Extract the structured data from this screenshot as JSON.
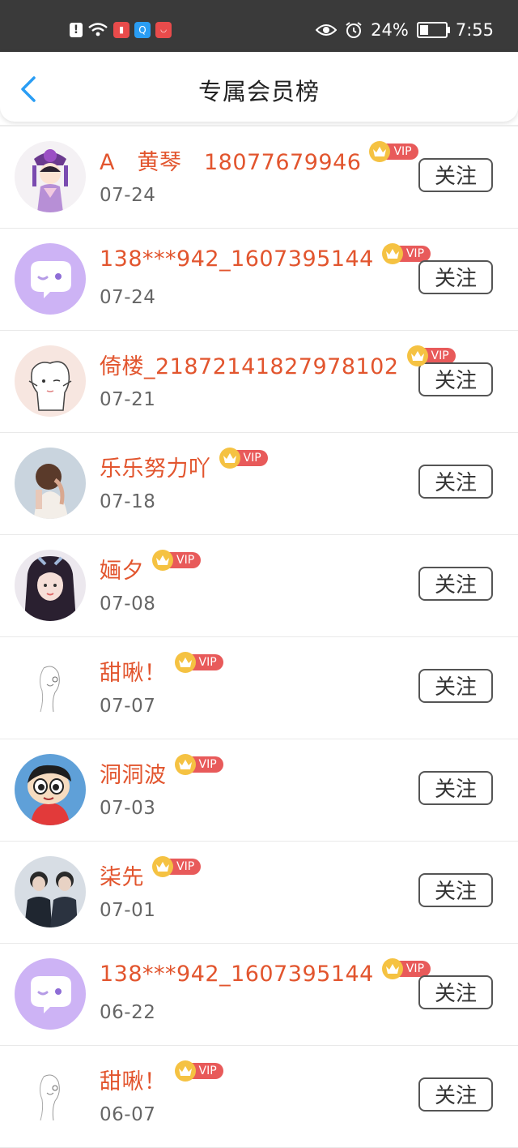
{
  "status_bar": {
    "battery": "24%",
    "time": "7:55",
    "icons": [
      "warning-icon",
      "wifi-icon",
      "app-icon",
      "search-app-icon",
      "huawei-app-icon",
      "eye-icon",
      "alarm-icon",
      "battery-icon"
    ]
  },
  "header": {
    "title": "专属会员榜",
    "back_icon": "chevron-left-icon"
  },
  "colors": {
    "accent_name": "#e2552e",
    "vip_tag": "#e85a5a",
    "crown": "#f5c242",
    "back_arrow": "#2a9df4"
  },
  "follow_label": "关注",
  "vip_label": "VIP",
  "members": [
    {
      "name": "A　黄琴　18077679946",
      "date": "07-24",
      "avatar": "avatar-qing-princess"
    },
    {
      "name": "138***942_1607395144",
      "date": "07-24",
      "avatar": "avatar-default-chat"
    },
    {
      "name": "倚楼_21872141827978102",
      "date": "07-21",
      "avatar": "avatar-alpaca"
    },
    {
      "name": "乐乐努力吖",
      "date": "07-18",
      "avatar": "avatar-girl-back"
    },
    {
      "name": "婳夕",
      "date": "07-08",
      "avatar": "avatar-girl-photo"
    },
    {
      "name": "甜啾！",
      "date": "07-07",
      "avatar": "avatar-sketch-girl"
    },
    {
      "name": "洞洞波",
      "date": "07-03",
      "avatar": "avatar-cartoon-boy"
    },
    {
      "name": "柒先",
      "date": "07-01",
      "avatar": "avatar-two-men"
    },
    {
      "name": "138***942_1607395144",
      "date": "06-22",
      "avatar": "avatar-default-chat"
    },
    {
      "name": "甜啾！",
      "date": "06-07",
      "avatar": "avatar-sketch-girl"
    }
  ]
}
